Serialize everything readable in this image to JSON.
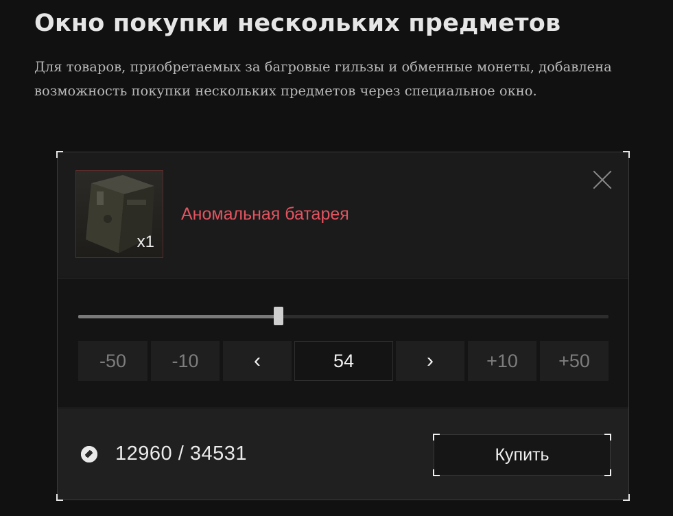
{
  "page": {
    "title": "Окно покупки нескольких предметов",
    "description": "Для товаров, приобретаемых за багровые гильзы и обменные монеты, добавлена возможность покупки нескольких предметов через специальное окно."
  },
  "dialog": {
    "item": {
      "name": "Аномальная батарея",
      "quantity_badge": "x1",
      "icon": "battery-item-icon",
      "name_color": "#e25460"
    },
    "close_icon": "close-icon",
    "slider": {
      "fraction": 0.378
    },
    "steps": {
      "minus50": "-50",
      "minus10": "-10",
      "prev": "‹",
      "value": "54",
      "next": "›",
      "plus10": "+10",
      "plus50": "+50"
    },
    "currency": {
      "icon": "currency-coin-icon",
      "balance_text": "12960 / 34531"
    },
    "buy_label": "Купить"
  }
}
